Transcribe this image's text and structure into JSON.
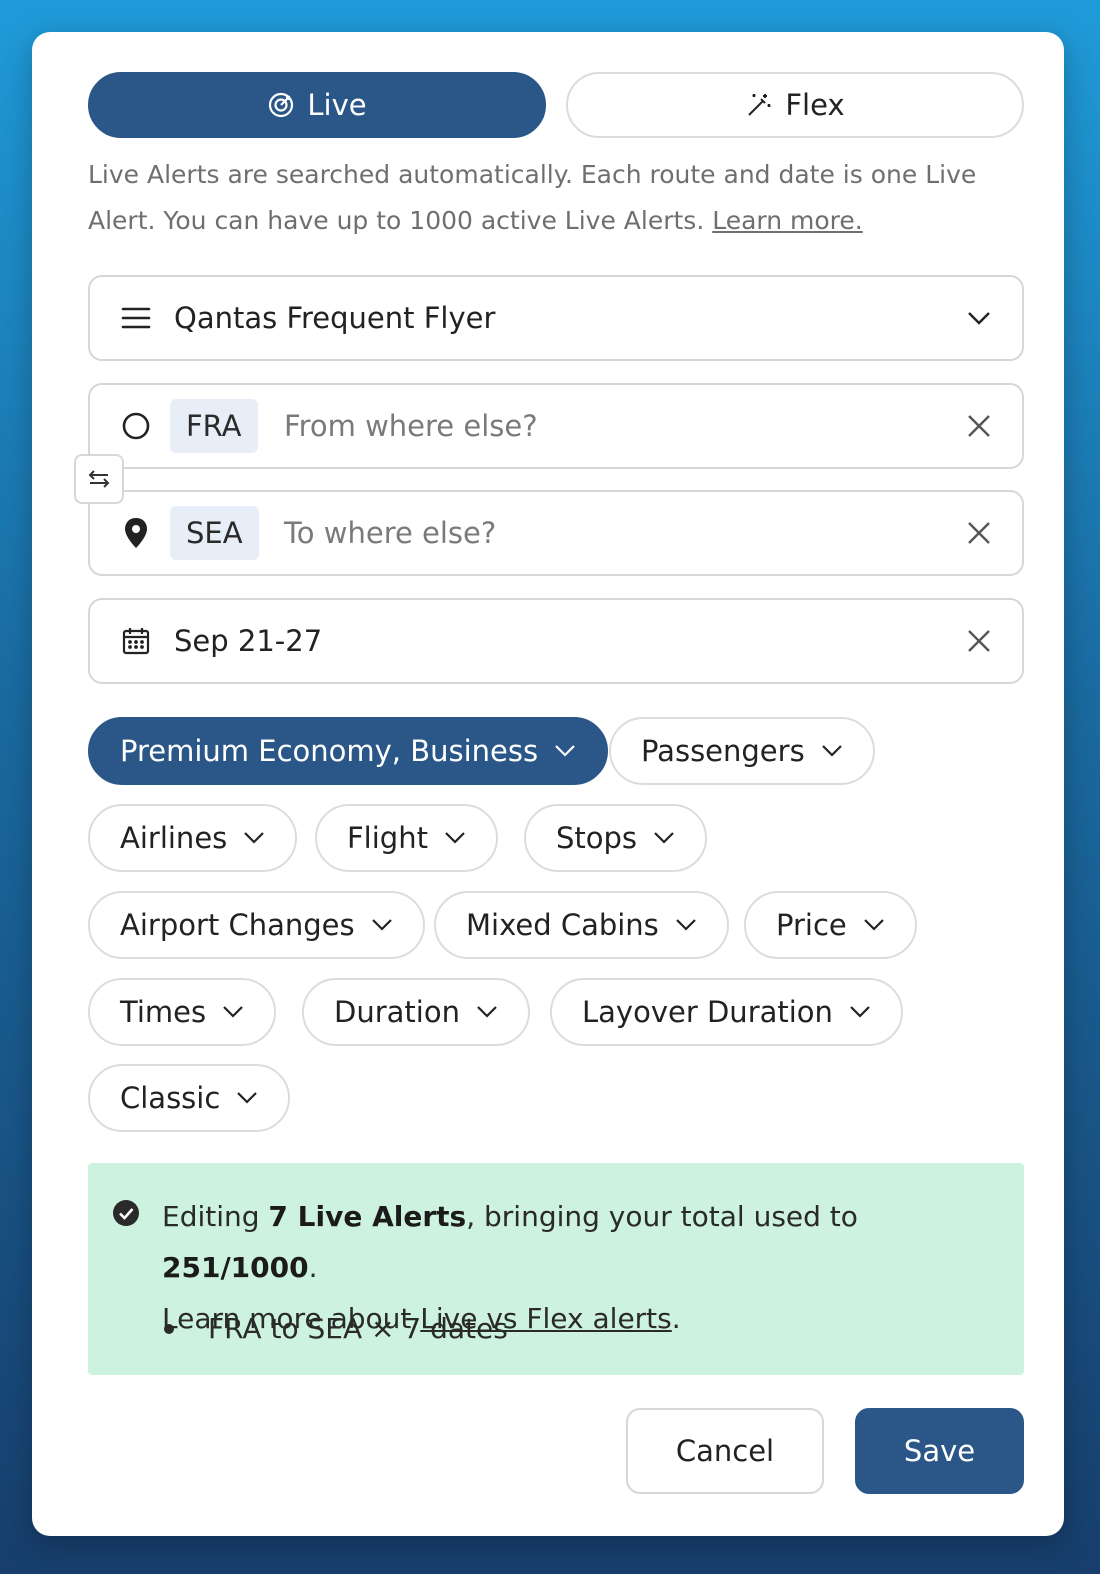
{
  "modes": {
    "live_label": "Live",
    "flex_label": "Flex",
    "active": "Live"
  },
  "description": {
    "text": "Live Alerts are searched automatically. Each route and date is one Live Alert. You can have up to 1000 active Live Alerts. ",
    "link": "Learn more."
  },
  "program": {
    "value": "Qantas Frequent Flyer"
  },
  "origin": {
    "code": "FRA",
    "placeholder": "From where else?"
  },
  "destination": {
    "code": "SEA",
    "placeholder": "To where else?"
  },
  "dates": {
    "value": "Sep 21-27"
  },
  "filters": {
    "cabin": "Premium Economy, Business",
    "passengers": "Passengers",
    "airlines": "Airlines",
    "flight": "Flight",
    "stops": "Stops",
    "airport_changes": "Airport Changes",
    "mixed_cabins": "Mixed Cabins",
    "price": "Price",
    "times": "Times",
    "duration": "Duration",
    "layover_duration": "Layover Duration",
    "view": "Classic"
  },
  "info": {
    "prefix": "Editing ",
    "count_bold": "7 Live Alerts",
    "middle": ", bringing your total used to ",
    "total_bold": "251/1000",
    "end": ".",
    "learn_prefix": "Learn more about ",
    "learn_link": "Live vs Flex alerts",
    "learn_suffix": ".",
    "bullets": [
      "FRA to SEA × 7 dates"
    ]
  },
  "actions": {
    "cancel": "Cancel",
    "save": "Save"
  },
  "colors": {
    "primary": "#2a5788",
    "info_bg": "#cdf2df",
    "chip_bg": "#e7eef7"
  }
}
